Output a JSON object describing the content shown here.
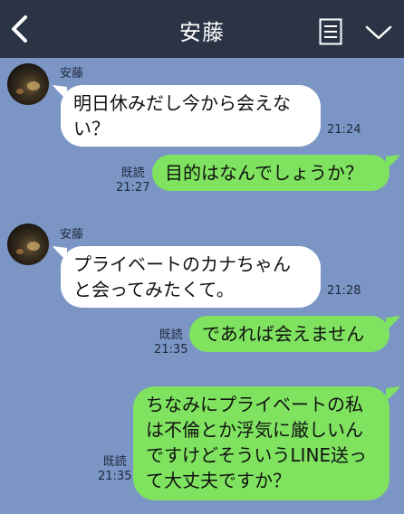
{
  "header": {
    "title": "安藤",
    "back_icon": "chevron-left-icon",
    "menu_icon": "list-icon",
    "dropdown_icon": "chevron-down-icon"
  },
  "messages": [
    {
      "sender": "安藤",
      "text": "明日休みだし今から会えない？",
      "time": "21:24"
    },
    {
      "read": "既読",
      "text": "目的はなんでしょうか？",
      "time": "21:27"
    },
    {
      "sender": "安藤",
      "text": "プライベートのカナちゃんと会ってみたくて。",
      "time": "21:28"
    },
    {
      "read": "既読",
      "text": "であれば会えません",
      "time": "21:35"
    },
    {
      "read": "既読",
      "text": "ちなみにプライベートの私は不倫とか浮気に厳しいんですけどそういうLINE送って大丈夫ですか？",
      "time": "21:35"
    }
  ],
  "colors": {
    "background": "#7b95c5",
    "header": "#2b3445",
    "incoming_bubble": "#ffffff",
    "outgoing_bubble": "#7fe360"
  }
}
